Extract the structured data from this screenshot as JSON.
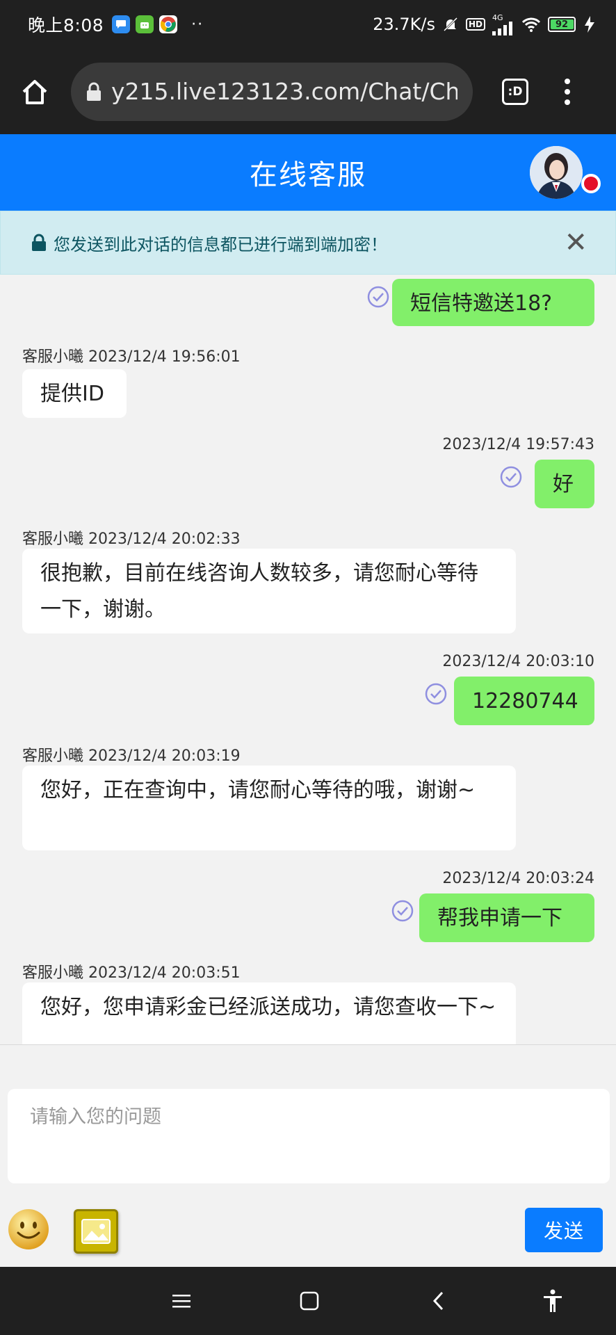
{
  "status_bar": {
    "time": "晚上8:08",
    "dots": "··",
    "net_speed": "23.7K/s",
    "hd": "HD",
    "network": "4G",
    "battery": "92"
  },
  "browser": {
    "url": "y215.live123123.com/Chat/Chat",
    "tab_label": ":D"
  },
  "header": {
    "title": "在线客服"
  },
  "notice": {
    "text": "您发送到此对话的信息都已进行端到端加密！",
    "close": "✕"
  },
  "messages": [
    {
      "side": "right",
      "time": "",
      "text": "短信特邀送18?"
    },
    {
      "side": "left",
      "meta": "客服小曦 2023/12/4 19:56:01",
      "text": "提供ID"
    },
    {
      "side": "right",
      "time": "2023/12/4 19:57:43",
      "text": "好"
    },
    {
      "side": "left",
      "meta": "客服小曦 2023/12/4 20:02:33",
      "text": "很抱歉，目前在线咨询人数较多，请您耐心等待一下，谢谢。"
    },
    {
      "side": "right",
      "time": "2023/12/4 20:03:10",
      "text": "12280744"
    },
    {
      "side": "left",
      "meta": "客服小曦 2023/12/4 20:03:19",
      "text": "您好，正在查询中，请您耐心等待的哦，谢谢~"
    },
    {
      "side": "right",
      "time": "2023/12/4 20:03:24",
      "text": "帮我申请一下"
    },
    {
      "side": "left",
      "meta": "客服小曦 2023/12/4 20:03:51",
      "text": "您好，您申请彩金已经派送成功，请您查收一下~"
    }
  ],
  "input": {
    "placeholder": "请输入您的问题",
    "send_label": "发送"
  },
  "colors": {
    "header": "#0a7cff",
    "my_bubble": "#82ef6a",
    "notice_bg": "#d1ecf1",
    "status_dot": "#e4102a"
  },
  "icons": {
    "home": "home-icon",
    "lock": "lock-icon",
    "check": "check-circle-icon",
    "emoji": "emoji-icon",
    "image": "image-icon"
  }
}
